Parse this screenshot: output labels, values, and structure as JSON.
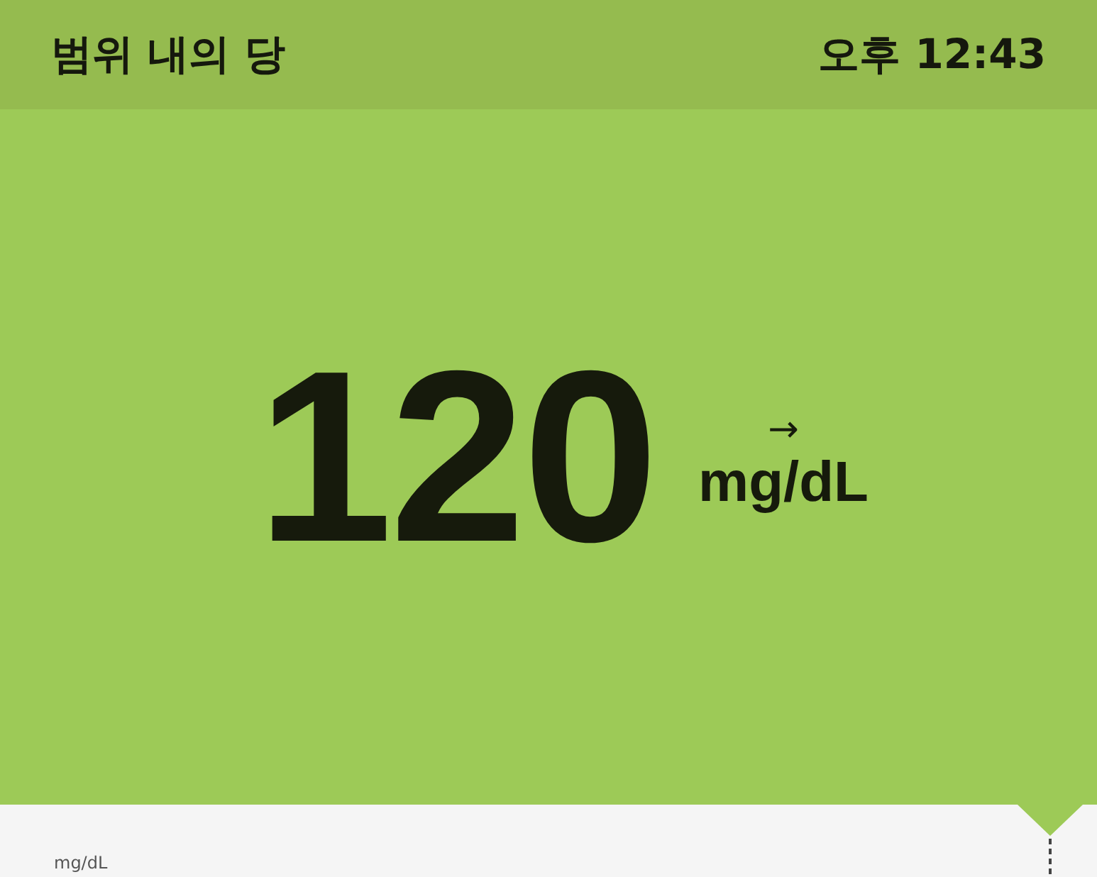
{
  "header": {
    "title": "범위 내의 당",
    "time": "오후 12:43"
  },
  "reading": {
    "value": "120",
    "trend_arrow": "→",
    "unit": "mg/dL"
  },
  "chart_panel": {
    "axis_unit": "mg/dL"
  }
}
